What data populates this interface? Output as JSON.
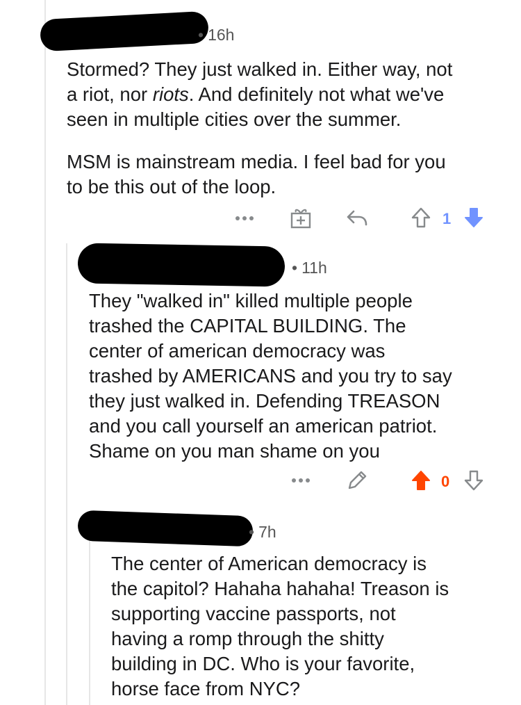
{
  "colors": {
    "upvote_active": "#ff4500",
    "downvote_active": "#7193ff",
    "icon_gray": "#878a8c",
    "text": "#1a1a1b"
  },
  "comments": [
    {
      "time": "16h",
      "paragraph1": [
        "Stormed? They just walked in. Either way, not",
        "a riot, nor ",
        "riots",
        ". And definitely not what we've",
        "seen in multiple cities over the summer."
      ],
      "paragraph2": [
        "MSM is mainstream media. I feel bad for you",
        "to be this out of the loop."
      ],
      "votes": "1",
      "actions": [
        "more-icon",
        "award-icon",
        "reply-icon",
        "upvote-icon",
        "downvote-icon"
      ]
    },
    {
      "time": "11h",
      "lines": [
        "They \"walked in\" killed multiple people",
        "trashed the CAPITAL BUILDING. The",
        "center of american democracy was",
        "trashed by AMERICANS and you try to say",
        "they just walked in. Defending TREASON",
        "and you call yourself an american patriot.",
        "Shame on you man shame on you"
      ],
      "votes": "0",
      "actions": [
        "more-icon",
        "edit-icon",
        "upvote-icon",
        "downvote-icon"
      ]
    },
    {
      "time": "7h",
      "lines": [
        "The center of American democracy is",
        "the capitol? Hahaha hahaha! Treason is",
        "supporting vaccine passports, not",
        "having a romp through the shitty",
        "building in DC. Who is your favorite,",
        "horse face from NYC?"
      ]
    }
  ]
}
